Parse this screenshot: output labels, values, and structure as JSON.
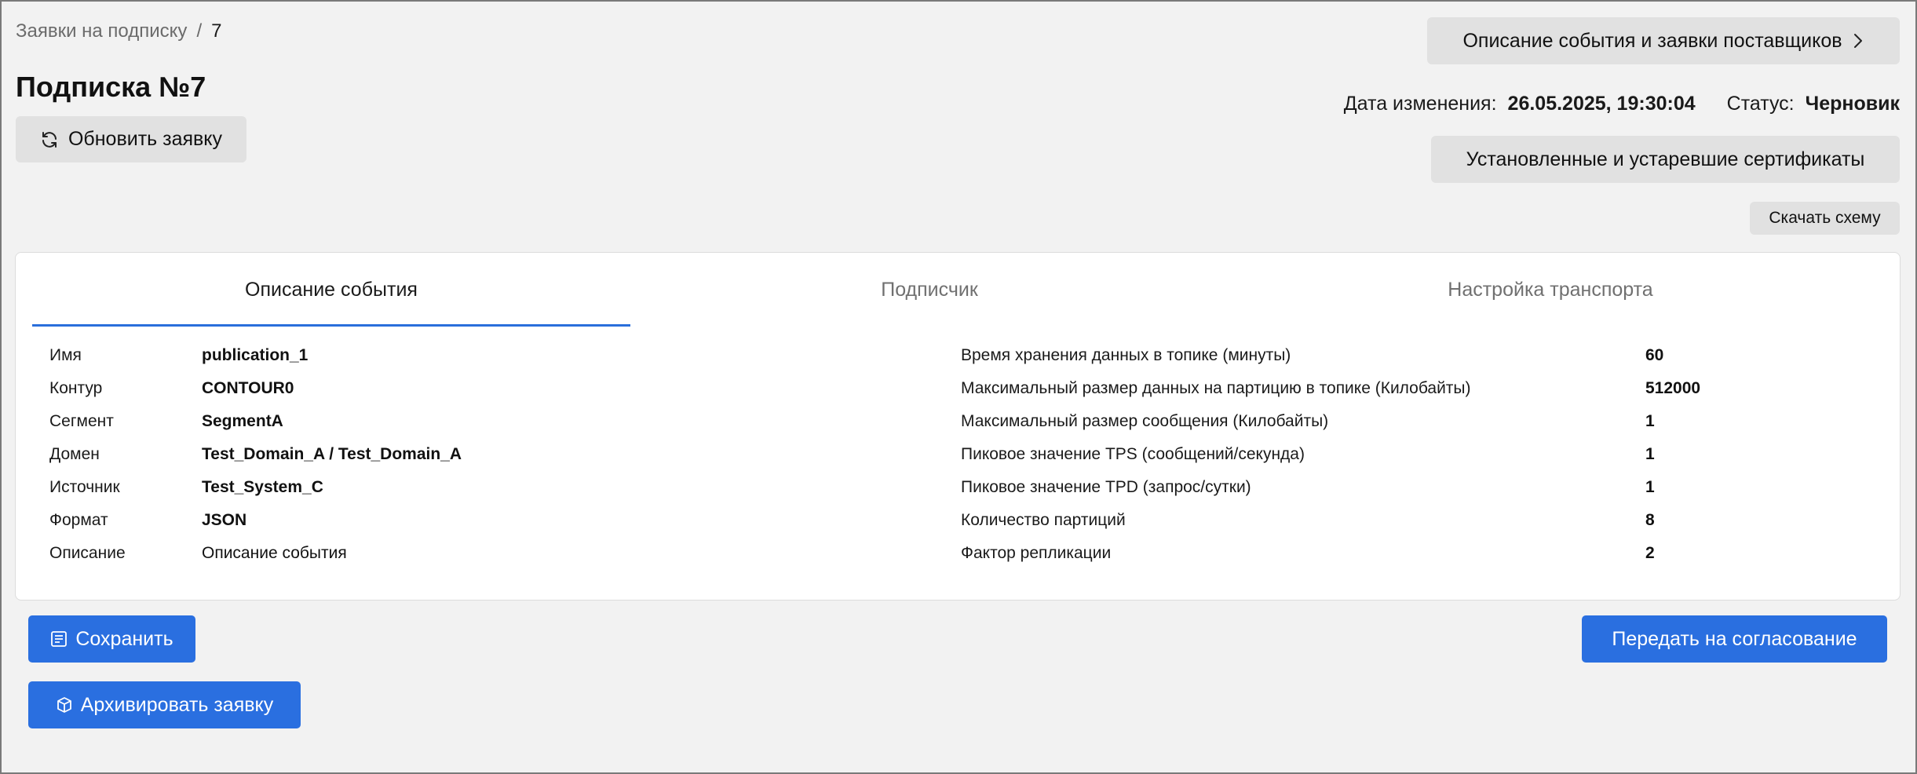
{
  "breadcrumb": {
    "parent": "Заявки на подписку",
    "separator": "/",
    "current": "7"
  },
  "page_title": "Подписка №7",
  "header": {
    "refresh_label": "Обновить заявку",
    "events_label": "Описание события и заявки поставщиков",
    "modified_label": "Дата изменения:",
    "modified_value": "26.05.2025, 19:30:04",
    "status_label": "Статус:",
    "status_value": "Черновик",
    "certs_label": "Установленные и устаревшие сертификаты",
    "schema_label": "Скачать схему"
  },
  "tabs": [
    {
      "label": "Описание события",
      "active": true
    },
    {
      "label": "Подписчик",
      "active": false
    },
    {
      "label": "Настройка транспорта",
      "active": false
    }
  ],
  "left_fields": [
    {
      "label": "Имя",
      "value": "publication_1"
    },
    {
      "label": "Контур",
      "value": "CONTOUR0"
    },
    {
      "label": "Сегмент",
      "value": "SegmentA"
    },
    {
      "label": "Домен",
      "value": "Test_Domain_A / Test_Domain_A"
    },
    {
      "label": "Источник",
      "value": "Test_System_C"
    },
    {
      "label": "Формат",
      "value": "JSON"
    },
    {
      "label": "Описание",
      "value": "Описание события"
    }
  ],
  "right_fields": [
    {
      "label": "Время хранения данных в топике (минуты)",
      "value": "60"
    },
    {
      "label": "Максимальный размер данных на партицию в топике (Килобайты)",
      "value": "512000"
    },
    {
      "label": "Максимальный размер сообщения (Килобайты)",
      "value": "1"
    },
    {
      "label": "Пиковое значение TPS (сообщений/секунда)",
      "value": "1"
    },
    {
      "label": "Пиковое значение TPD (запрос/сутки)",
      "value": "1"
    },
    {
      "label": "Количество партиций",
      "value": "8"
    },
    {
      "label": "Фактор репликации",
      "value": "2"
    }
  ],
  "actions": {
    "save_label": "Сохранить",
    "submit_label": "Передать на согласование",
    "archive_label": "Архивировать заявку"
  },
  "colors": {
    "primary": "#2a6fe0",
    "background": "#f2f2f2",
    "button_gray": "#e1e1e1"
  }
}
